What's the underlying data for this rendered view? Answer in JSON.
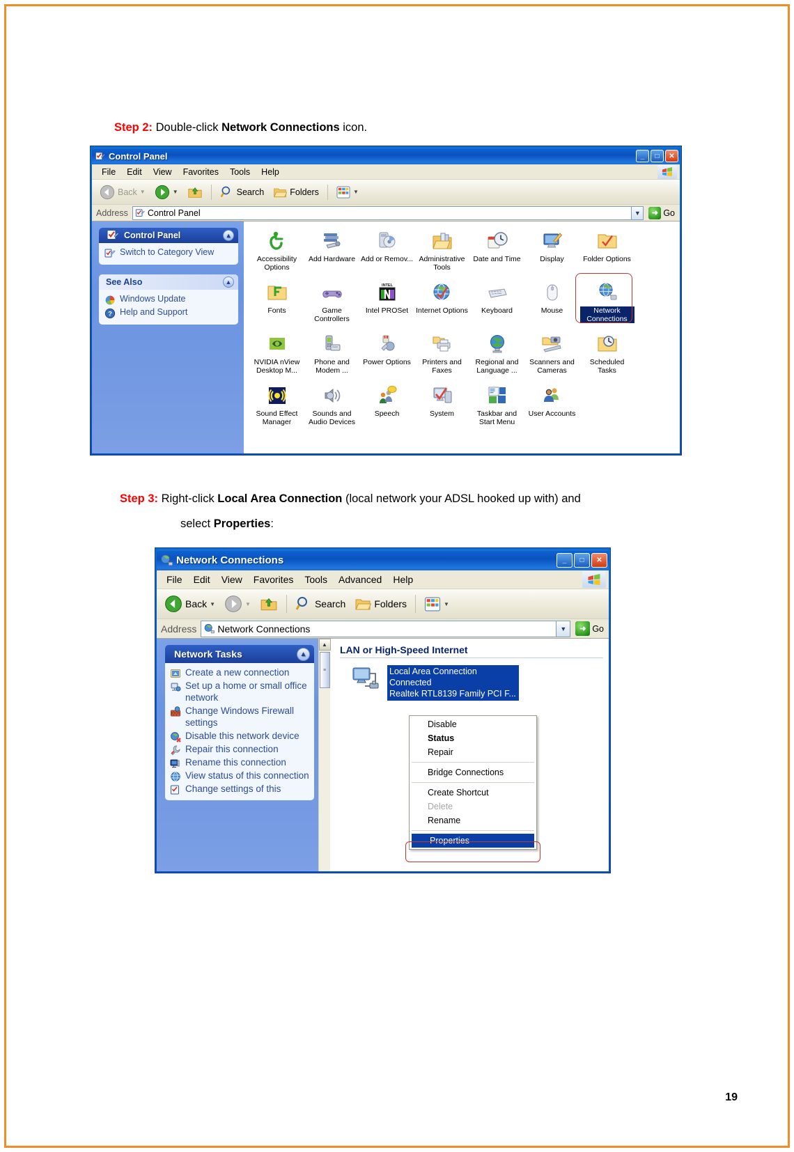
{
  "page": {
    "number": "19"
  },
  "steps": {
    "step2": {
      "label": "Step 2:",
      "text_before": " Double-click ",
      "bold": "Network Connections",
      "text_after": " icon."
    },
    "step3": {
      "label": "Step 3:",
      "text_before": " Right-click ",
      "bold": "Local Area Connection",
      "text_after": " (local network your ADSL hooked up with) and",
      "line2_before": "select ",
      "line2_bold": "Properties",
      "line2_after": ":"
    }
  },
  "control_panel": {
    "title": "Control Panel",
    "title_icon": "control-panel-icon",
    "window_buttons": {
      "minimize": "_",
      "maximize": "□",
      "close": "✕"
    },
    "menu": [
      "File",
      "Edit",
      "View",
      "Favorites",
      "Tools",
      "Help"
    ],
    "toolbar": {
      "back": "Back",
      "forward": "",
      "up": "",
      "search": "Search",
      "folders": "Folders",
      "views": ""
    },
    "address": {
      "label": "Address",
      "value": "Control Panel",
      "go": "Go"
    },
    "taskpane": {
      "groups": [
        {
          "title": "Control Panel",
          "style": "dark",
          "items": [
            {
              "label": "Switch to Category View",
              "icon": "switch-view-icon"
            }
          ]
        },
        {
          "title": "See Also",
          "style": "light",
          "items": [
            {
              "label": "Windows Update",
              "icon": "windows-update-icon"
            },
            {
              "label": "Help and Support",
              "icon": "help-support-icon"
            }
          ]
        }
      ]
    },
    "icons": [
      [
        {
          "label": "Accessibility Options",
          "icon": "accessibility-icon"
        },
        {
          "label": "Add Hardware",
          "icon": "add-hardware-icon"
        },
        {
          "label": "Add or Remov...",
          "icon": "add-remove-programs-icon"
        },
        {
          "label": "Administrative Tools",
          "icon": "administrative-tools-icon"
        },
        {
          "label": "Date and Time",
          "icon": "date-time-icon"
        },
        {
          "label": "Display",
          "icon": "display-icon"
        },
        {
          "label": "Folder Options",
          "icon": "folder-options-icon"
        }
      ],
      [
        {
          "label": "Fonts",
          "icon": "fonts-icon"
        },
        {
          "label": "Game Controllers",
          "icon": "game-controllers-icon"
        },
        {
          "label": "Intel PROSet",
          "icon": "intel-proset-icon"
        },
        {
          "label": "Internet Options",
          "icon": "internet-options-icon"
        },
        {
          "label": "Keyboard",
          "icon": "keyboard-icon"
        },
        {
          "label": "Mouse",
          "icon": "mouse-icon"
        },
        {
          "label": "Network Connections",
          "icon": "network-connections-icon",
          "selected": true
        }
      ],
      [
        {
          "label": "NVIDIA nView Desktop M...",
          "icon": "nvidia-nview-icon"
        },
        {
          "label": "Phone and Modem ...",
          "icon": "phone-modem-icon"
        },
        {
          "label": "Power Options",
          "icon": "power-options-icon"
        },
        {
          "label": "Printers and Faxes",
          "icon": "printers-faxes-icon"
        },
        {
          "label": "Regional and Language ...",
          "icon": "regional-language-icon"
        },
        {
          "label": "Scanners and Cameras",
          "icon": "scanners-cameras-icon"
        },
        {
          "label": "Scheduled Tasks",
          "icon": "scheduled-tasks-icon"
        }
      ],
      [
        {
          "label": "Sound Effect Manager",
          "icon": "sound-effect-manager-icon"
        },
        {
          "label": "Sounds and Audio Devices",
          "icon": "sounds-audio-icon"
        },
        {
          "label": "Speech",
          "icon": "speech-icon"
        },
        {
          "label": "System",
          "icon": "system-icon"
        },
        {
          "label": "Taskbar and Start Menu",
          "icon": "taskbar-start-menu-icon"
        },
        {
          "label": "User Accounts",
          "icon": "user-accounts-icon"
        }
      ]
    ]
  },
  "network_connections": {
    "title": "Network Connections",
    "title_icon": "network-connections-icon",
    "window_buttons": {
      "minimize": "_",
      "maximize": "□",
      "close": "✕"
    },
    "menu": [
      "File",
      "Edit",
      "View",
      "Favorites",
      "Tools",
      "Advanced",
      "Help"
    ],
    "toolbar": {
      "back": "Back",
      "search": "Search",
      "folders": "Folders"
    },
    "address": {
      "label": "Address",
      "value": "Network Connections",
      "go": "Go"
    },
    "taskpane": {
      "title": "Network Tasks",
      "items": [
        {
          "label": "Create a new connection",
          "icon": "new-connection-icon"
        },
        {
          "label": "Set up a home or small office network",
          "icon": "home-network-icon"
        },
        {
          "label": "Change Windows Firewall settings",
          "icon": "firewall-icon"
        },
        {
          "label": "Disable this network device",
          "icon": "disable-device-icon"
        },
        {
          "label": "Repair this connection",
          "icon": "repair-icon"
        },
        {
          "label": "Rename this connection",
          "icon": "rename-icon"
        },
        {
          "label": "View status of this connection",
          "icon": "view-status-icon"
        },
        {
          "label": "Change settings of this",
          "icon": "change-settings-icon"
        }
      ]
    },
    "group_header": "LAN or High-Speed Internet",
    "connection": {
      "name": "Local Area Connection",
      "status": "Connected",
      "adapter": "Realtek RTL8139 Family PCI F...",
      "icon": "lan-connection-icon"
    },
    "context_menu": [
      {
        "label": "Disable",
        "style": "normal"
      },
      {
        "label": "Status",
        "style": "bold"
      },
      {
        "label": "Repair",
        "style": "normal"
      },
      {
        "separator": true
      },
      {
        "label": "Bridge Connections",
        "style": "normal"
      },
      {
        "separator": true
      },
      {
        "label": "Create Shortcut",
        "style": "normal"
      },
      {
        "label": "Delete",
        "style": "disabled"
      },
      {
        "label": "Rename",
        "style": "normal"
      },
      {
        "separator": true
      },
      {
        "label": "Properties",
        "style": "highlight"
      }
    ]
  },
  "colors": {
    "accent_orange": "#F28C28",
    "step_red": "#FF0000",
    "xp_blue": "#0A52C0",
    "selection_blue": "#0A3FA8",
    "highlight_red": "#C0392B"
  }
}
